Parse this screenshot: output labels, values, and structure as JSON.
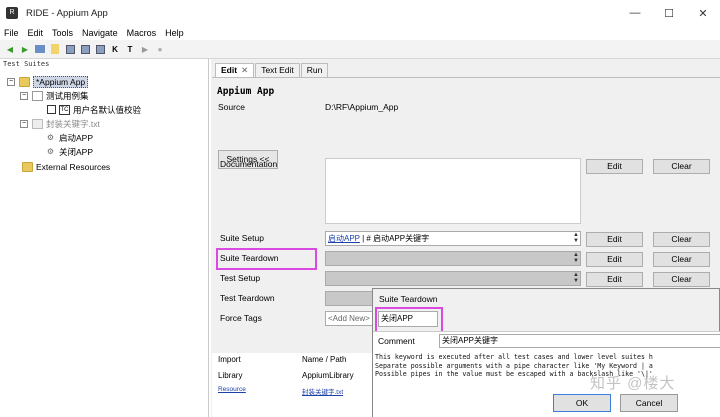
{
  "window": {
    "title": "RIDE - Appium App",
    "app_icon": "ride-icon"
  },
  "menu": [
    "File",
    "Edit",
    "Tools",
    "Navigate",
    "Macros",
    "Help"
  ],
  "tree": {
    "panel_title": "Test Suites",
    "root": "*Appium App",
    "folder1": "测试用例集",
    "test1": "用户名默认值校验",
    "resource": "封装关键字.txt",
    "kw1": "启动APP",
    "kw2": "关闭APP",
    "external": "External Resources"
  },
  "tabs": [
    "Edit",
    "Text Edit",
    "Run"
  ],
  "suite": {
    "name": "Appium App",
    "source_label": "Source",
    "source_value": "D:\\RF\\Appium_App",
    "settings_button": "Settings <<",
    "documentation_label": "Documentation",
    "suite_setup_label": "Suite Setup",
    "suite_setup_kw": "启动APP",
    "suite_setup_rest": " | # 启动APP关键字",
    "suite_teardown_label": "Suite Teardown",
    "test_setup_label": "Test Setup",
    "test_teardown_label": "Test Teardown",
    "force_tags_label": "Force Tags",
    "force_tags_placeholder": "<Add New>",
    "edit_label": "Edit",
    "clear_label": "Clear"
  },
  "imports": {
    "headers": [
      "Import",
      "Name / Path"
    ],
    "rows": [
      {
        "type": "Library",
        "path": "AppiumLibrary"
      },
      {
        "type": "Resource",
        "path": "封装关键字.txt"
      }
    ]
  },
  "dialog": {
    "title": "Suite Teardown",
    "keyword_value": "关闭APP",
    "comment_label": "Comment",
    "comment_value": "关闭APP关键字",
    "help_lines": [
      "This keyword is executed after all test cases and lower level suites h",
      "Separate possible arguments with a pipe character like 'My Keyword | a",
      "Possible pipes in the value must be escaped with a backslash like '\\|'"
    ],
    "ok_label": "OK",
    "cancel_label": "Cancel"
  },
  "watermark": "知乎 @楼大",
  "colors": {
    "highlight": "#d94be0",
    "link": "#1a3fa8"
  }
}
